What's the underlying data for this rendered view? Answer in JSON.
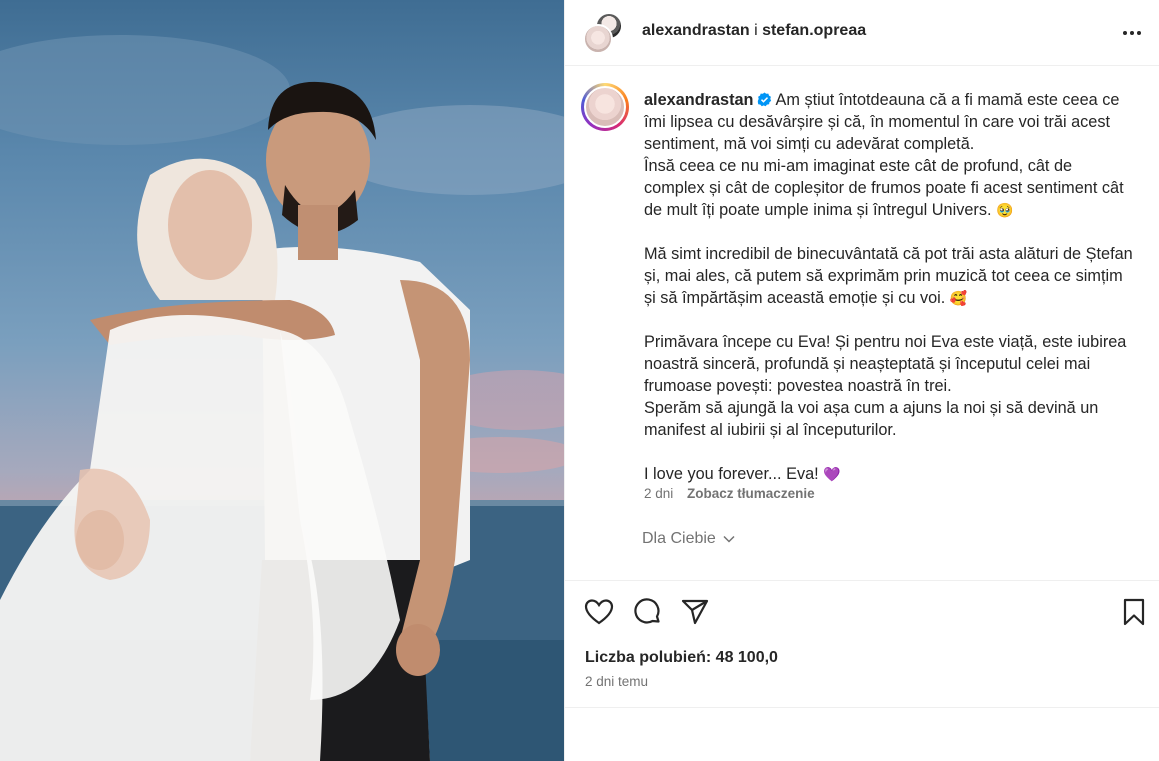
{
  "header": {
    "user1": "alexandrastan",
    "separator": "i",
    "user2": "stefan.opreaa",
    "more_icon": "more-horizontal-icon"
  },
  "caption": {
    "username": "alexandrastan",
    "paragraph1": "Am știut întotdeauna că a fi mamă este ceea ce îmi lipsea cu desăvârșire și că, în momentul în care voi trăi acest sentiment, mă voi simți cu adevărat completă.",
    "paragraph1b": "Însă ceea ce nu mi-am imaginat este cât de profund, cât de complex și cât de copleșitor de frumos poate fi acest sentiment cât de mult îți poate umple inima și întregul Univers.",
    "emoji1": "🥹",
    "paragraph2": "Mă simt incredibil de binecuvântată că pot trăi asta alături de Ștefan și, mai ales, că putem să exprimăm prin muzică tot ceea ce simțim și să împărtășim această emoție și cu voi.",
    "emoji2": "🥰",
    "paragraph3": "Primăvara începe cu Eva! Și pentru noi Eva este viață, este iubirea noastră sinceră, profundă și neașteptată și începutul celei mai frumoase povești: povestea noastră în trei.",
    "paragraph3b": "Sperăm să ajungă la voi așa cum a ajuns la noi și să devină un manifest al iubirii și al începuturilor.",
    "paragraph4": "I love you forever... Eva!",
    "emoji4": "💜",
    "age": "2 dni",
    "translate": "Zobacz tłumaczenie",
    "for_you": "Dla Ciebie"
  },
  "actions": {
    "icons": [
      "heart-icon",
      "comment-icon",
      "share-icon",
      "bookmark-icon"
    ]
  },
  "likes": {
    "label": "Liczba polubień: 48 100,0"
  },
  "timestamp": "2 dni temu",
  "colors": {
    "text": "#262626",
    "secondary": "#737373",
    "verified": "#0095f6",
    "border": "#efefef"
  }
}
